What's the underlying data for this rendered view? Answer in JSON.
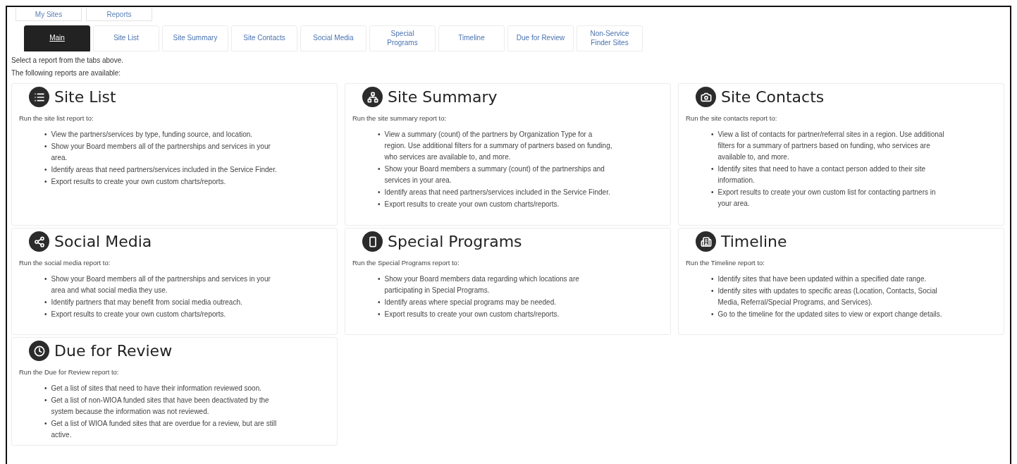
{
  "top_tabs": [
    {
      "label": "My Sites"
    },
    {
      "label": "Reports"
    }
  ],
  "report_tabs": [
    {
      "label": "Main",
      "selected": true
    },
    {
      "label": "Site List",
      "selected": false
    },
    {
      "label": "Site Summary",
      "selected": false
    },
    {
      "label": "Site Contacts",
      "selected": false
    },
    {
      "label": "Social Media",
      "selected": false
    },
    {
      "label": "Special Programs",
      "selected": false
    },
    {
      "label": "Timeline",
      "selected": false
    },
    {
      "label": "Due for Review",
      "selected": false
    },
    {
      "label": "Non-Service Finder Sites",
      "selected": false
    }
  ],
  "intro": [
    "Select a report from the tabs above.",
    "The following reports are available:"
  ],
  "reports": [
    {
      "marker": "•",
      "title": "Site List",
      "lead": "Run the site list report to:",
      "bullets": [
        "View the partners/services by type, funding source, and location.",
        "Show your Board members all of the partnerships and services in your area.",
        "Identify areas that need partners/services included in the Service Finder.",
        "Export results to create your own custom charts/reports."
      ]
    },
    {
      "marker": "•",
      "title": "Site Summary",
      "lead": "Run the site summary report to:",
      "bullets": [
        "View a summary (count) of the partners by Organization Type for a region. Use additional filters for a summary of partners based on funding, who services are available to, and more.",
        "Show your Board members a summary (count) of the partnerships and services in your area.",
        "Identify areas that need partners/services included in the Service Finder.",
        "Export results to create your own custom charts/reports."
      ]
    },
    {
      "marker": "•",
      "title": "Site Contacts",
      "lead": "Run the site contacts report to:",
      "bullets": [
        "View a list of contacts for partner/referral sites in a region. Use additional filters for a summary of partners based on funding, who services are available to, and more.",
        "Identify sites that need to have a contact person added to their site information.",
        "Export results to create your own custom list for contacting partners in your area."
      ]
    },
    {
      "marker": "•",
      "title": "Social Media",
      "lead": "Run the social media report to:",
      "bullets": [
        "Show your Board members all of the partnerships and services in your area and what social media they use.",
        "Identify partners that may benefit from social media outreach.",
        "Export results to create your own custom charts/reports."
      ]
    },
    {
      "marker": "•",
      "title": "Special Programs",
      "lead": "Run the Special Programs report to:",
      "bullets": [
        "Show your Board members data regarding which locations are participating in Special Programs.",
        "Identify areas where special programs may be needed.",
        "Export results to create your own custom charts/reports."
      ]
    },
    {
      "marker": "•",
      "title": "Timeline",
      "lead": "Run the Timeline report to:",
      "bullets": [
        "Identify sites that have been updated within a specified date range.",
        "Identify sites with updates to specific areas (Location, Contacts, Social Media, Referral/Special Programs, and Services).",
        "Go to the timeline for the updated sites to view or export change details."
      ]
    },
    {
      "marker": "•",
      "title": "Due for Review",
      "lead": "Run the Due for Review report to:",
      "bullets": [
        "Get a list of sites that need to have their information reviewed soon.",
        "Get a list of non-WIOA funded sites that have been deactivated by the system because the information was not reviewed.",
        "Get a list of WIOA funded sites that are overdue for a review, but are still active."
      ]
    }
  ]
}
